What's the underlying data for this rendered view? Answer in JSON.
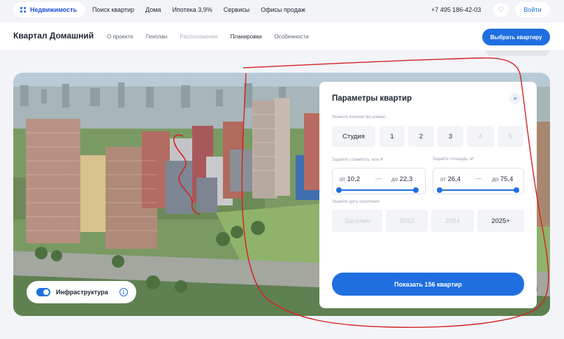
{
  "topbar": {
    "brand": "Недвижимость",
    "nav": [
      "Поиск квартир",
      "Дома",
      "Ипотека 3,9%",
      "Сервисы",
      "Офисы продаж"
    ],
    "phone": "+7 495 186-42-03",
    "login": "Войти"
  },
  "project": {
    "title": "Квартал Домашний",
    "nav": [
      "О проекте",
      "Генплан",
      "Расположение",
      "Планировки",
      "Особенности"
    ],
    "cta": "Выбрать квартиру"
  },
  "hero": {
    "infrastructure_label": "Инфраструктура",
    "infrastructure_on": true
  },
  "params": {
    "title": "Параметры квартир",
    "rooms_label": "Укажите количество комнат",
    "rooms": [
      "Студия",
      "1",
      "2",
      "3",
      "4",
      "5"
    ],
    "price_label": "Задайте стоимость, млн ₽",
    "price_from_prefix": "от",
    "price_from": "10,2",
    "price_to_prefix": "до",
    "price_to": "22,3",
    "area_label": "Задайте площадь, м²",
    "area_from_prefix": "от",
    "area_from": "26,4",
    "area_to_prefix": "до",
    "area_to": "75,4",
    "date_label": "Укажите дату заселения",
    "years": [
      "Заселен",
      "2023",
      "2024",
      "2025+"
    ],
    "submit": "Показать 156 квартир"
  },
  "colors": {
    "accent": "#1f6fe0",
    "annotation": "#d62020"
  }
}
